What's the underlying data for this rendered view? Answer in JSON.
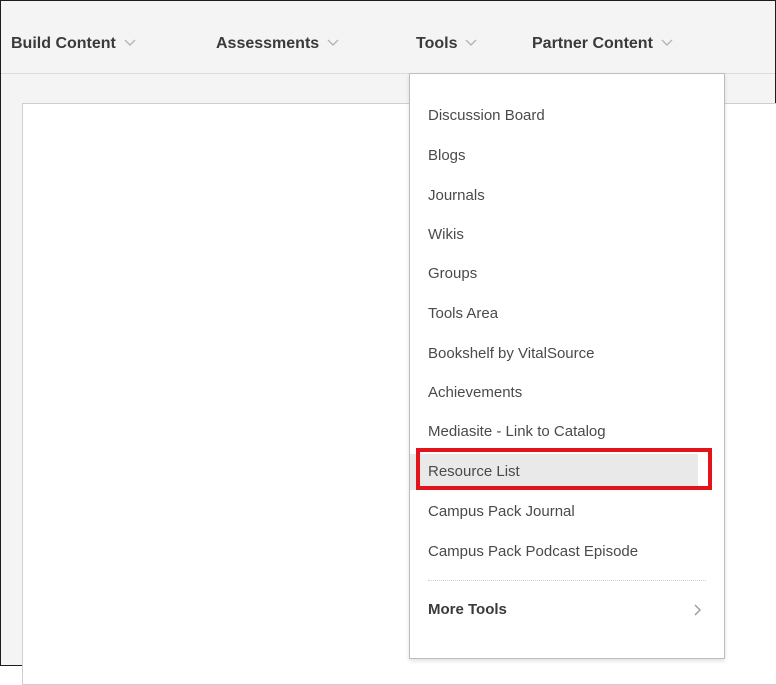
{
  "toolbar": {
    "menus": [
      {
        "label": "Build Content"
      },
      {
        "label": "Assessments"
      },
      {
        "label": "Tools"
      },
      {
        "label": "Partner Content"
      }
    ]
  },
  "tools_menu": {
    "items": [
      {
        "label": "Discussion Board"
      },
      {
        "label": "Blogs"
      },
      {
        "label": "Journals"
      },
      {
        "label": "Wikis"
      },
      {
        "label": "Groups"
      },
      {
        "label": "Tools Area"
      },
      {
        "label": "Bookshelf by VitalSource"
      },
      {
        "label": "Achievements"
      },
      {
        "label": "Mediasite - Link to Catalog"
      },
      {
        "label": "Resource List"
      },
      {
        "label": "Campus Pack Journal"
      },
      {
        "label": "Campus Pack Podcast Episode"
      }
    ],
    "more_tools": "More Tools",
    "highlighted_item": "Resource List",
    "highlight_color": "#e3131b"
  },
  "icons": {
    "menu_chevron": "chevron-down-icon",
    "submenu_chevron": "chevron-right-icon"
  }
}
